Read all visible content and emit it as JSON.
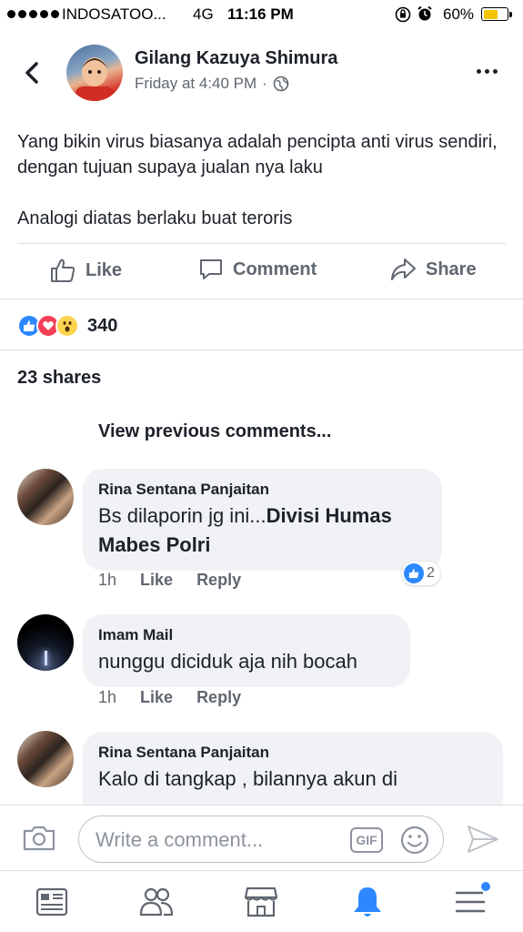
{
  "status_bar": {
    "carrier": "INDOSATOO...",
    "network": "4G",
    "time": "11:16 PM",
    "battery_percent": "60%",
    "battery_level": 0.6,
    "battery_color": "#f5c400"
  },
  "post": {
    "author": "Gilang Kazuya Shimura",
    "timestamp": "Friday at 4:40 PM",
    "separator": "·",
    "privacy_icon": "globe-icon",
    "text": [
      "Yang bikin virus biasanya adalah pencipta anti virus sendiri, dengan tujuan supaya jualan nya laku",
      "Analogi diatas berlaku buat teroris"
    ],
    "actions": {
      "like": "Like",
      "comment": "Comment",
      "share": "Share"
    },
    "reactions": {
      "types": [
        "like",
        "love",
        "wow"
      ],
      "count": "340"
    },
    "shares": "23 shares"
  },
  "comments": {
    "view_previous": "View previous comments...",
    "items": [
      {
        "author": "Rina Sentana Panjaitan",
        "text_plain": "Bs dilaporin jg ini...",
        "text_bold": "Divisi Humas Mabes Polri",
        "time": "1h",
        "like": "Like",
        "reply": "Reply",
        "like_count": "2"
      },
      {
        "author": "Imam Mail",
        "text_plain": "nunggu diciduk aja nih bocah",
        "time": "1h",
        "like": "Like",
        "reply": "Reply"
      },
      {
        "author": "Rina Sentana Panjaitan",
        "text_plain": "Kalo di tangkap , bilannya akun di"
      }
    ]
  },
  "composer": {
    "placeholder": "Write a comment...",
    "gif_label": "GIF"
  },
  "tab_bar": {
    "tabs": [
      "news-feed",
      "friends",
      "marketplace",
      "notifications",
      "menu"
    ],
    "active": "notifications"
  },
  "colors": {
    "accent": "#2d88ff",
    "text": "#1d2129",
    "secondary": "#616770",
    "bubble": "#f0f2f5"
  }
}
